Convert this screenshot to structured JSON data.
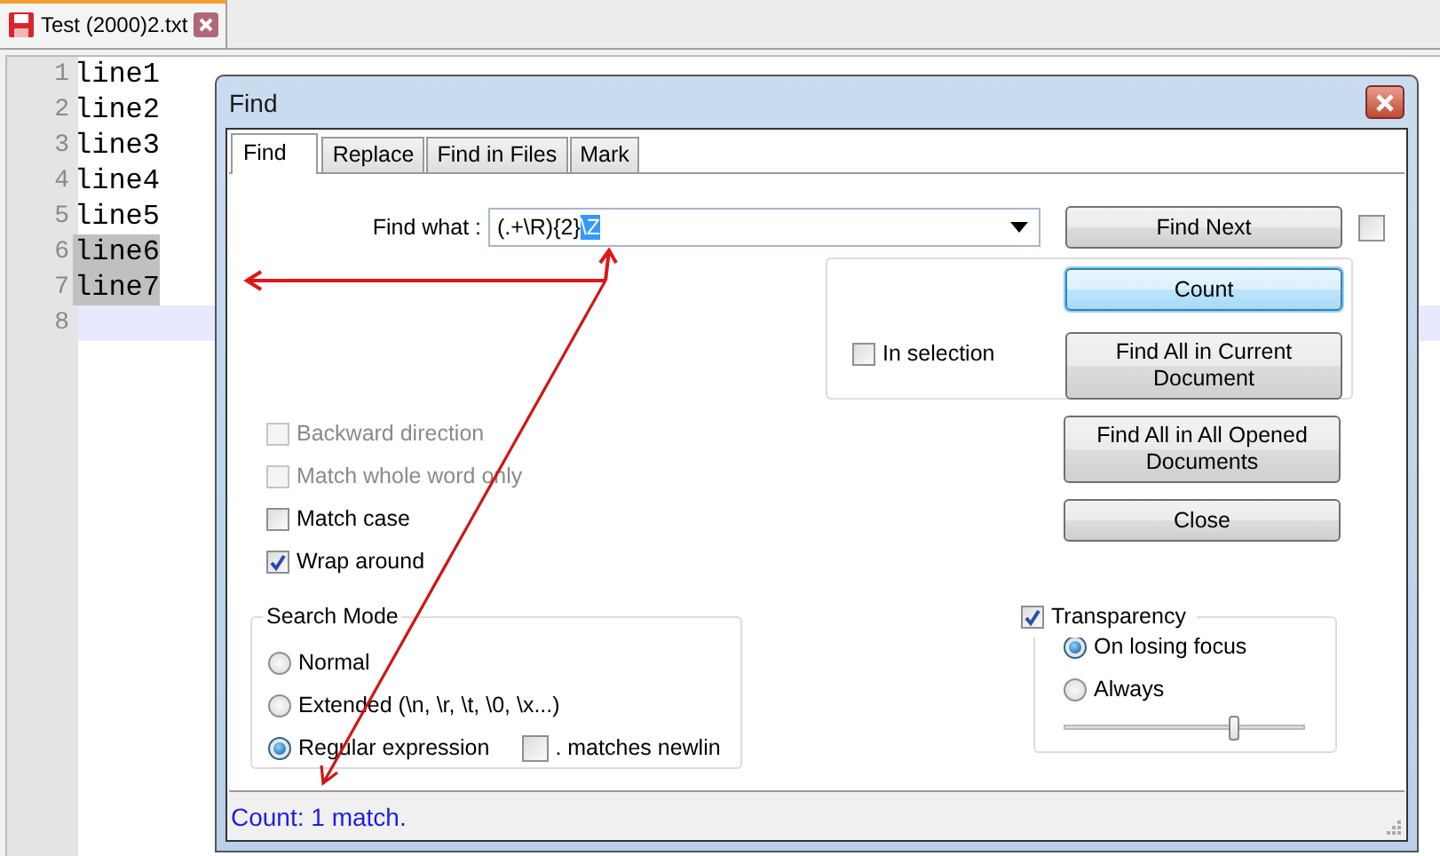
{
  "file_tab": {
    "label": "Test (2000)2.txt"
  },
  "editor": {
    "lines": [
      {
        "number": "1",
        "text": "line1",
        "selected": false,
        "current": false
      },
      {
        "number": "2",
        "text": "line2",
        "selected": false,
        "current": false
      },
      {
        "number": "3",
        "text": "line3",
        "selected": false,
        "current": false
      },
      {
        "number": "4",
        "text": "line4",
        "selected": false,
        "current": false
      },
      {
        "number": "5",
        "text": "line5",
        "selected": false,
        "current": false
      },
      {
        "number": "6",
        "text": "line6",
        "selected": true,
        "current": false
      },
      {
        "number": "7",
        "text": "line7",
        "selected": true,
        "current": false
      },
      {
        "number": "8",
        "current": true
      }
    ]
  },
  "dialog": {
    "title": "Find",
    "tabs": [
      {
        "label": "Find",
        "selected": true
      },
      {
        "label": "Replace",
        "selected": false
      },
      {
        "label": "Find in Files",
        "selected": false
      },
      {
        "label": "Mark",
        "selected": false
      }
    ],
    "find_what": {
      "label": "Find what :",
      "value": "(.+\\R){2}",
      "selected_text": "\\Z"
    },
    "side_checkbox": {
      "checked": false
    },
    "buttons": [
      {
        "label": "Find Next",
        "focused": false
      },
      {
        "label": "Count",
        "focused": true
      },
      {
        "label": "Find All in Current Document",
        "focused": false
      },
      {
        "label": "Find All in All Opened Documents",
        "focused": false
      },
      {
        "label": "Close",
        "focused": false
      }
    ],
    "in_selection": {
      "label": "In selection",
      "checked": false
    },
    "options": [
      {
        "label": "Backward direction",
        "checked": false,
        "disabled": true
      },
      {
        "label": "Match whole word only",
        "checked": false,
        "disabled": true
      },
      {
        "label": "Match case",
        "checked": false,
        "disabled": false
      },
      {
        "label": "Wrap around",
        "checked": true,
        "disabled": false
      }
    ],
    "search_mode": {
      "title": "Search Mode",
      "options": [
        {
          "label": "Normal",
          "selected": false
        },
        {
          "label": "Extended (\\n, \\r, \\t, \\0, \\x...)",
          "selected": false
        },
        {
          "label": "Regular expression",
          "selected": true
        }
      ],
      "matches_newline": {
        "label": ". matches newlin",
        "checked": false
      }
    },
    "transparency": {
      "label": "Transparency",
      "checked": true,
      "options": [
        {
          "label": "On losing focus",
          "selected": true
        },
        {
          "label": "Always",
          "selected": false
        }
      ],
      "level": 0.71
    },
    "status": "Count: 1 match."
  }
}
